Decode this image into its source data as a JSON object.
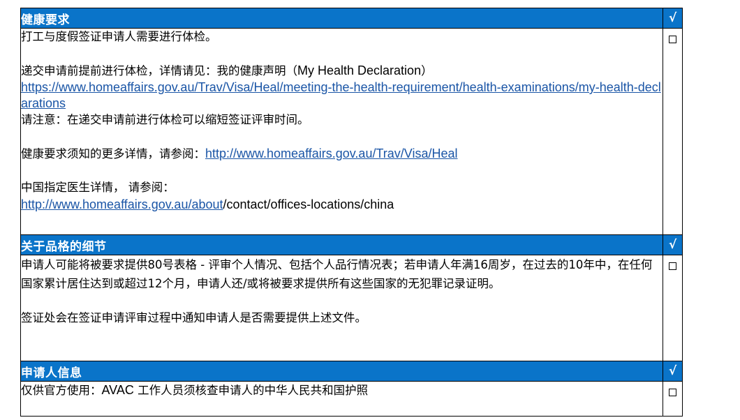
{
  "sections": [
    {
      "header": "健康要求",
      "tick": "√",
      "lines": {
        "l1": "打工与度假签证申请人需要进行体检。",
        "l2_cn": "递交申请前提前进行体检，详情请见：我的健康声明（",
        "l2_en": "My Health Declaration",
        "l2_end": "）",
        "link1": "https://www.homeaffairs.gov.au/Trav/Visa/Heal/meeting-the-health-requirement/health-examinations/my-health-declarations",
        "l3": "请注意：在递交申请前进行体检可以缩短签证评审时间。",
        "l4_cn": "健康要求须知的更多详情，请参阅：",
        "link2": "http://www.homeaffairs.gov.au/Trav/Visa/Heal",
        "l5": "中国指定医生详情，  请参阅：",
        "link3": "http://www.homeaffairs.gov.au/about",
        "l6_rest": "/contact/offices-locations/china"
      }
    },
    {
      "header": "关于品格的细节",
      "tick": "√",
      "lines": {
        "p1": "申请人可能将被要求提供80号表格 - 评审个人情况、包括个人品行情况表；若申请人年满16周岁，在过去的10年中，在任何国家累计居住达到或超过12个月，申请人还/或将被要求提供所有这些国家的无犯罪记录证明。",
        "p2": "签证处会在签证申请评审过程中通知申请人是否需要提供上述文件。"
      }
    },
    {
      "header": "申请人信息",
      "tick": "√",
      "lines": {
        "p1_cn": "仅供官方使用：",
        "p1_en": "AVAC",
        "p1_rest": " 工作人员须核查申请人的中华人民共和国护照"
      }
    }
  ]
}
